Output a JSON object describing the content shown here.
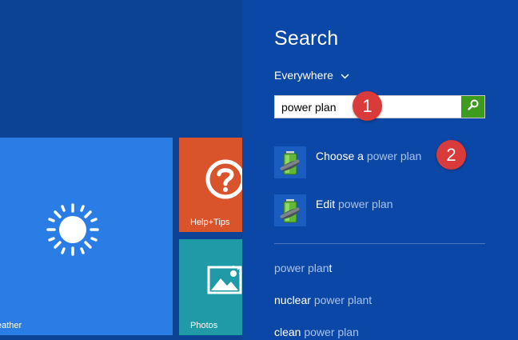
{
  "start_screen": {
    "tiles": {
      "weather": {
        "label": "eather",
        "color": "#2a7de4"
      },
      "help": {
        "label": "Help+Tips",
        "color": "#d9532b"
      },
      "photos": {
        "label": "Photos",
        "color": "#1f9aa6"
      }
    }
  },
  "search": {
    "title": "Search",
    "scope": {
      "label": "Everywhere",
      "icon": "chevron-down-icon"
    },
    "query": "power plan",
    "button_icon": "search-icon",
    "results": [
      {
        "prefix": "Choose a ",
        "match": "power plan",
        "icon": "battery-settings-icon"
      },
      {
        "prefix": "Edit ",
        "match": "power plan",
        "icon": "battery-settings-icon"
      }
    ],
    "suggestions": [
      {
        "before": "power plan",
        "highlight": "t",
        "after": ""
      },
      {
        "before": "nuclear ",
        "highlight": "power plant",
        "after": ""
      },
      {
        "before": "clean ",
        "highlight": "power plan",
        "after": ""
      }
    ]
  },
  "callouts": [
    {
      "number": "1"
    },
    {
      "number": "2"
    }
  ],
  "colors": {
    "panel": "#0b47a6",
    "start_bg": "#0d4394",
    "accent_green": "#3d9c1e",
    "badge": "#d93a3a"
  }
}
